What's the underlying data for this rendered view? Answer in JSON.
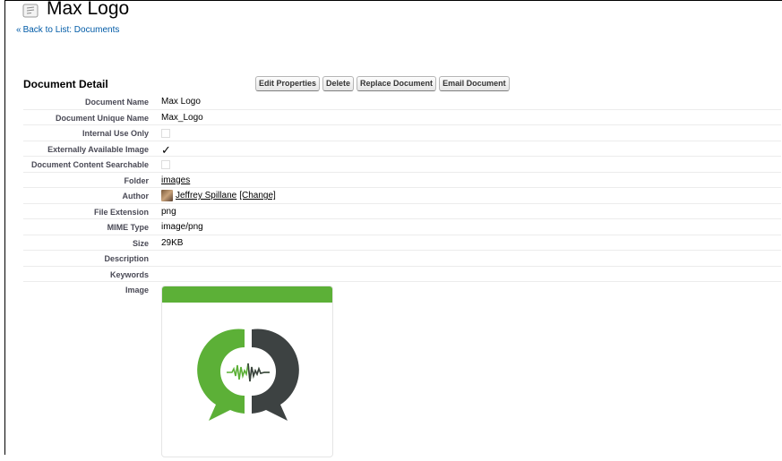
{
  "header": {
    "title": "Max Logo",
    "back_link": "Back to List: Documents",
    "back_prefix": "«"
  },
  "section": {
    "title": "Document Detail"
  },
  "buttons": {
    "edit": "Edit Properties",
    "delete": "Delete",
    "replace": "Replace Document",
    "email": "Email Document"
  },
  "fields": {
    "document_name": {
      "label": "Document Name",
      "value": "Max Logo"
    },
    "unique_name": {
      "label": "Document Unique Name",
      "value": "Max_Logo"
    },
    "internal_use": {
      "label": "Internal Use Only",
      "checked": false
    },
    "externally_available": {
      "label": "Externally Available Image",
      "checked": true,
      "mark": "✓"
    },
    "content_searchable": {
      "label": "Document Content Searchable",
      "checked": false
    },
    "folder": {
      "label": "Folder",
      "value": "images"
    },
    "author": {
      "label": "Author",
      "value": "Jeffrey Spillane",
      "change": "[Change]"
    },
    "file_extension": {
      "label": "File Extension",
      "value": "png"
    },
    "mime_type": {
      "label": "MIME Type",
      "value": "image/png"
    },
    "size": {
      "label": "Size",
      "value": "29KB"
    },
    "description": {
      "label": "Description",
      "value": ""
    },
    "keywords": {
      "label": "Keywords",
      "value": ""
    },
    "image": {
      "label": "Image"
    }
  },
  "colors": {
    "link": "#015ba7",
    "logo_green": "#5cb037",
    "logo_dark": "#3d4242"
  }
}
